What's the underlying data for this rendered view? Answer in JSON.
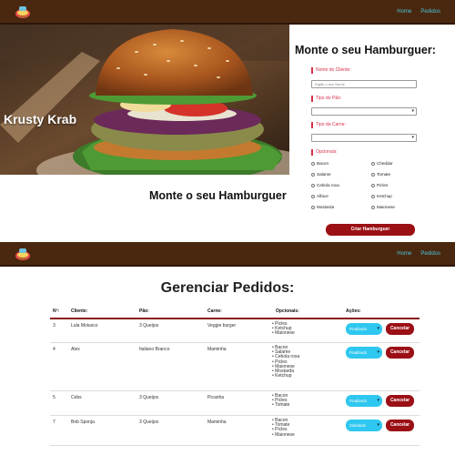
{
  "nav": {
    "links": [
      "Home",
      "Pedidos"
    ]
  },
  "hero": {
    "title": "Krusty Krab"
  },
  "form": {
    "title": "Monte o seu Hamburguer:",
    "name_label": "Nome do Cliente:",
    "name_placeholder": "Digite o seu Nome",
    "bread_label": "Tipo do Pão:",
    "meat_label": "Tipo da Carne:",
    "extras_label": "Opcionais:",
    "extras": [
      "Bacon",
      "Cheddar",
      "Salame",
      "Tomate",
      "Cebola roxa",
      "Picles",
      "Alface",
      "Ketchup",
      "Mostarda",
      "Maionese"
    ],
    "submit_label": "Criar Hamburguer"
  },
  "section_heading": "Monte o seu Hamburguer",
  "orders": {
    "title": "Gerenciar Pedidos:",
    "headers": [
      "Nº:",
      "Cliente:",
      "Pão:",
      "Carne:",
      "Opcionais:",
      "Ações:"
    ],
    "cancel_label": "Cancelar",
    "rows": [
      {
        "id": "3",
        "client": "Lula Molusco",
        "bread": "3 Queijos",
        "meat": "Veggie burger",
        "extras": [
          "Picles",
          "Ketchup",
          "Maionese"
        ],
        "status": "Finalizado"
      },
      {
        "id": "4",
        "client": "Alex",
        "bread": "Italiano Branco",
        "meat": "Maminha",
        "extras": [
          "Bacon",
          "Salame",
          "Cebola roxa",
          "Picles",
          "Maionese",
          "Mostarda",
          "Ketchup"
        ],
        "status": "Finalizado"
      },
      {
        "id": "5",
        "client": "Cebs",
        "bread": "3 Queijos",
        "meat": "Picanha",
        "extras": [
          "Bacon",
          "Picles",
          "Tomate"
        ],
        "status": "Finalizado"
      },
      {
        "id": "7",
        "client": "Bob Sponja",
        "bread": "3 Queijos",
        "meat": "Maminha",
        "extras": [
          "Bacon",
          "Tomate",
          "Picles",
          "Maionese"
        ],
        "status": "Solicitado"
      }
    ]
  }
}
